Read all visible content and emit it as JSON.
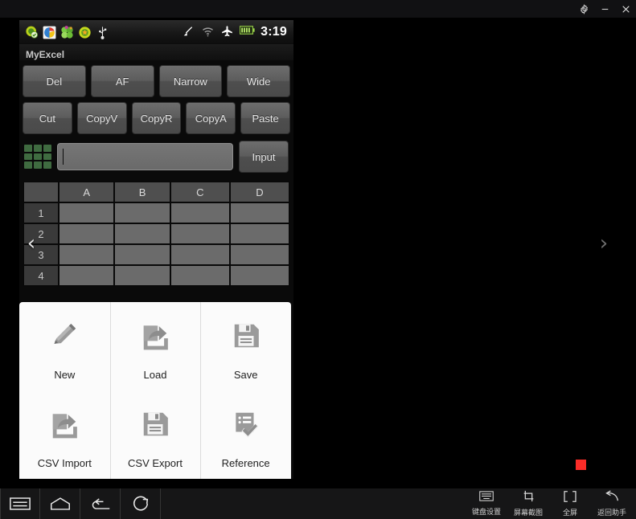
{
  "window": {
    "controls": [
      {
        "name": "settings-gear",
        "label": "settings"
      },
      {
        "name": "minimize",
        "label": "minimize"
      },
      {
        "name": "close",
        "label": "close"
      }
    ]
  },
  "status_bar": {
    "notification_icons": [
      "app-green-check-icon",
      "photos-icon",
      "clover-icon",
      "app-star-icon",
      "usb-icon"
    ],
    "system_icons": [
      "no-signal-icon",
      "wifi-icon",
      "airplane-mode-icon",
      "battery-icon"
    ],
    "time": "3:19"
  },
  "app": {
    "title": "MyExcel",
    "toolbar_row1": [
      "Del",
      "AF",
      "Narrow",
      "Wide"
    ],
    "toolbar_row2": [
      "Cut",
      "CopyV",
      "CopyR",
      "CopyA",
      "Paste"
    ],
    "formula_bar": {
      "grid_icon": "grid-3x3-icon",
      "value": "",
      "placeholder": "",
      "input_button": "Input"
    },
    "sheet": {
      "columns": [
        "A",
        "B",
        "C",
        "D"
      ],
      "rows": [
        "1",
        "2",
        "3",
        "4"
      ],
      "cells": [
        [
          "",
          "",
          "",
          ""
        ],
        [
          "",
          "",
          "",
          ""
        ],
        [
          "",
          "",
          "",
          ""
        ],
        [
          "",
          "",
          "",
          ""
        ]
      ]
    },
    "pager": {
      "prev": "‹",
      "next": "›"
    },
    "menu": [
      {
        "label": "New",
        "icon": "pencil-icon"
      },
      {
        "label": "Load",
        "icon": "import-arrow-icon"
      },
      {
        "label": "Save",
        "icon": "floppy-disk-icon"
      },
      {
        "label": "CSV Import",
        "icon": "import-arrow-icon"
      },
      {
        "label": "CSV Export",
        "icon": "floppy-disk-icon"
      },
      {
        "label": "Reference",
        "icon": "checklist-check-icon"
      }
    ]
  },
  "bottom_bar": {
    "nav": [
      {
        "name": "menu-icon",
        "label": "menu"
      },
      {
        "name": "home-icon",
        "label": "home"
      },
      {
        "name": "back-icon",
        "label": "back"
      },
      {
        "name": "rotate-icon",
        "label": "rotate"
      }
    ],
    "tools": [
      {
        "name": "keyboard-settings-icon",
        "label": "键盘设置"
      },
      {
        "name": "screenshot-icon",
        "label": "屏幕截图"
      },
      {
        "name": "fullscreen-icon",
        "label": "全屏"
      },
      {
        "name": "return-assistant-icon",
        "label": "返回助手"
      }
    ]
  },
  "marker": {
    "name": "red-square-marker",
    "color": "#fb2c28"
  }
}
